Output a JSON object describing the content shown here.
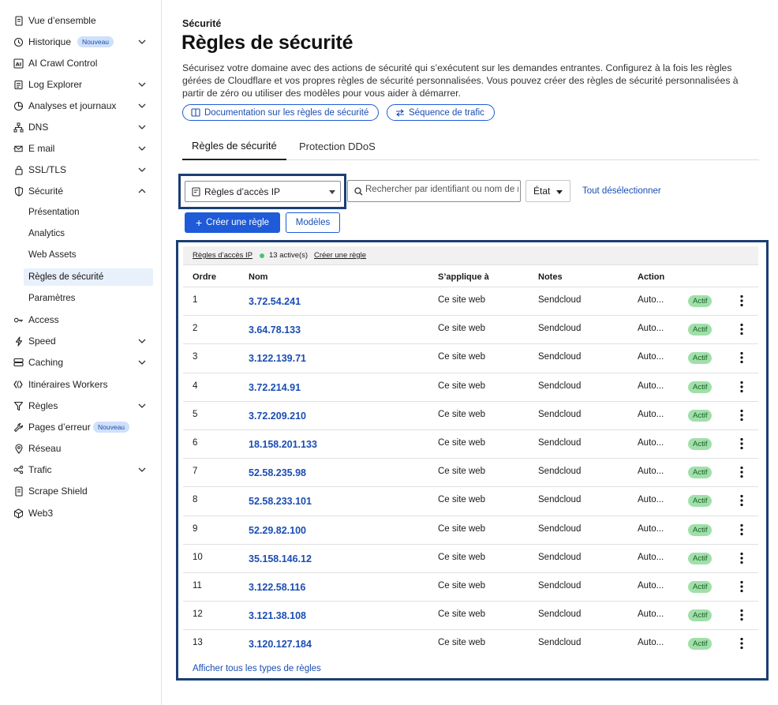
{
  "sidebar": {
    "items": [
      {
        "label": "Vue d’ensemble",
        "icon": "document-icon",
        "chevron": false
      },
      {
        "label": "Historique",
        "icon": "history-icon",
        "chevron": true,
        "badge": "Nouveau"
      },
      {
        "label": "AI Crawl Control",
        "icon": "ai-icon",
        "chevron": false
      },
      {
        "label": "Log Explorer",
        "icon": "log-icon",
        "chevron": true
      },
      {
        "label": "Analyses et journaux",
        "icon": "analytics-icon",
        "chevron": true
      },
      {
        "label": "DNS",
        "icon": "network-icon",
        "chevron": true
      },
      {
        "label": "E mail",
        "icon": "email-icon",
        "chevron": true
      },
      {
        "label": "SSL/TLS",
        "icon": "lock-icon",
        "chevron": true
      },
      {
        "label": "Sécurité",
        "icon": "shield-icon",
        "chevron": true,
        "expanded": true
      },
      {
        "label": "Access",
        "icon": "access-icon",
        "chevron": false
      },
      {
        "label": "Speed",
        "icon": "bolt-icon",
        "chevron": true
      },
      {
        "label": "Caching",
        "icon": "storage-icon",
        "chevron": true
      },
      {
        "label": "Itinéraires Workers",
        "icon": "workers-icon",
        "chevron": false
      },
      {
        "label": "Règles",
        "icon": "rules-icon",
        "chevron": true
      },
      {
        "label": "Pages d’erreur",
        "icon": "wrench-icon",
        "chevron": false,
        "badge": "Nouveau"
      },
      {
        "label": "Réseau",
        "icon": "location-icon",
        "chevron": false
      },
      {
        "label": "Trafic",
        "icon": "traffic-icon",
        "chevron": true
      },
      {
        "label": "Scrape Shield",
        "icon": "document-icon",
        "chevron": false
      },
      {
        "label": "Web3",
        "icon": "web3-icon",
        "chevron": false
      }
    ],
    "security_sub": [
      "Présentation",
      "Analytics",
      "Web Assets",
      "Règles de sécurité",
      "Paramètres"
    ]
  },
  "header": {
    "breadcrumb": "Sécurité",
    "title": "Règles de sécurité",
    "description": "Sécurisez votre domaine avec des actions de sécurité qui s’exécutent sur les demandes entrantes. Configurez à la fois les règles gérées de Cloudflare et vos propres règles de sécurité personnalisées. Vous pouvez créer des règles de sécurité personnalisées à partir de zéro ou utiliser des modèles pour vous aider à démarrer.",
    "doc_link": "Documentation sur les règles de sécurité",
    "seq_link": "Séquence de trafic"
  },
  "tabs": [
    "Règles de sécurité",
    "Protection DDoS"
  ],
  "toolbar": {
    "rule_type": "Règles d’accès IP",
    "search_placeholder": "Rechercher par identifiant ou nom de règle",
    "state_label": "État",
    "deselect_label": "Tout désélectionner",
    "create_label": "Créer une règle",
    "templates_label": "Modèles"
  },
  "table": {
    "group_label": "Règles d’accès IP",
    "active_count": "13 active(s)",
    "create_link": "Créer une règle",
    "columns": [
      "Ordre",
      "Nom",
      "S’applique à",
      "Notes",
      "Action"
    ],
    "rows": [
      {
        "order": "1",
        "name": "3.72.54.241",
        "applies": "Ce site web",
        "notes": "Sendcloud",
        "action": "Auto...",
        "status": "Actif"
      },
      {
        "order": "2",
        "name": "3.64.78.133",
        "applies": "Ce site web",
        "notes": "Sendcloud",
        "action": "Auto...",
        "status": "Actif"
      },
      {
        "order": "3",
        "name": "3.122.139.71",
        "applies": "Ce site web",
        "notes": "Sendcloud",
        "action": "Auto...",
        "status": "Actif"
      },
      {
        "order": "4",
        "name": "3.72.214.91",
        "applies": "Ce site web",
        "notes": "Sendcloud",
        "action": "Auto...",
        "status": "Actif"
      },
      {
        "order": "5",
        "name": "3.72.209.210",
        "applies": "Ce site web",
        "notes": "Sendcloud",
        "action": "Auto...",
        "status": "Actif"
      },
      {
        "order": "6",
        "name": "18.158.201.133",
        "applies": "Ce site web",
        "notes": "Sendcloud",
        "action": "Auto...",
        "status": "Actif"
      },
      {
        "order": "7",
        "name": "52.58.235.98",
        "applies": "Ce site web",
        "notes": "Sendcloud",
        "action": "Auto...",
        "status": "Actif"
      },
      {
        "order": "8",
        "name": "52.58.233.101",
        "applies": "Ce site web",
        "notes": "Sendcloud",
        "action": "Auto...",
        "status": "Actif"
      },
      {
        "order": "9",
        "name": "52.29.82.100",
        "applies": "Ce site web",
        "notes": "Sendcloud",
        "action": "Auto...",
        "status": "Actif"
      },
      {
        "order": "10",
        "name": "35.158.146.12",
        "applies": "Ce site web",
        "notes": "Sendcloud",
        "action": "Auto...",
        "status": "Actif"
      },
      {
        "order": "11",
        "name": "3.122.58.116",
        "applies": "Ce site web",
        "notes": "Sendcloud",
        "action": "Auto...",
        "status": "Actif"
      },
      {
        "order": "12",
        "name": "3.121.38.108",
        "applies": "Ce site web",
        "notes": "Sendcloud",
        "action": "Auto...",
        "status": "Actif"
      },
      {
        "order": "13",
        "name": "3.120.127.184",
        "applies": "Ce site web",
        "notes": "Sendcloud",
        "action": "Auto...",
        "status": "Actif"
      }
    ],
    "footer_link": "Afficher tous les types de règles"
  },
  "colors": {
    "accent": "#1f5bd8",
    "link": "#1a4db3",
    "highlight": "#1a3f73",
    "status_bg": "#9fe0a9"
  }
}
